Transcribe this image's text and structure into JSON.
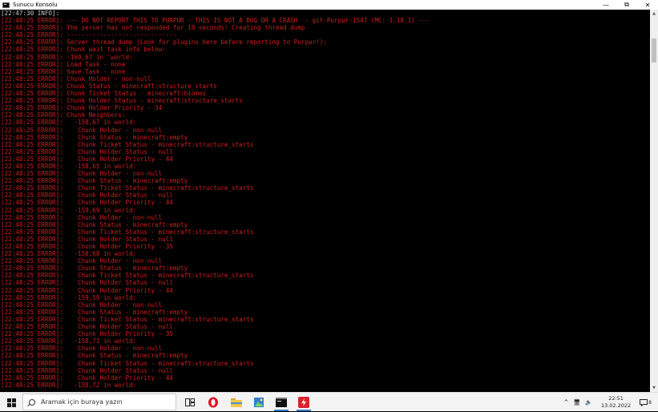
{
  "window": {
    "title": "Sunucu Konsolu",
    "minimize": "—",
    "maximize": "⧉",
    "close": "✕"
  },
  "console_lines": [
    {
      "t": "[22:47:30 INFO]:",
      "k": "info"
    },
    {
      "t": "[22:48:25 ERROR]: --- DO NOT REPORT THIS TO PURPUR - THIS IS NOT A BUG OR A CRASH  - git-Purpur-1547 (MC: 1.18.1) ---",
      "k": "err"
    },
    {
      "t": "[22:48:25 ERROR]: The server has not responded for 10 seconds! Creating thread dump",
      "k": "err"
    },
    {
      "t": "[22:48:25 ERROR]: ------------------------------",
      "k": "err"
    },
    {
      "t": "[22:48:25 ERROR]: Server thread dump (Look for plugins here before reporting to Purpur!):",
      "k": "err"
    },
    {
      "t": "[22:48:25 ERROR]: Chunk wait task info below:",
      "k": "err"
    },
    {
      "t": "[22:48:25 ERROR]: -160,67 in 'world:",
      "k": "err"
    },
    {
      "t": "[22:48:25 ERROR]: Load Task - none",
      "k": "err"
    },
    {
      "t": "[22:48:25 ERROR]: Save Task - none",
      "k": "err"
    },
    {
      "t": "[22:48:25 ERROR]: Chunk Holder - non-null",
      "k": "err"
    },
    {
      "t": "[22:48:25 ERROR]: Chunk Status - minecraft:structure_starts",
      "k": "err"
    },
    {
      "t": "[22:48:25 ERROR]: Chunk Ticket Status - minecraft:biomes",
      "k": "err"
    },
    {
      "t": "[22:48:25 ERROR]: Chunk Holder Status - minecraft:structure_starts",
      "k": "err"
    },
    {
      "t": "[22:48:25 ERROR]: Chunk Holder Priority - 34",
      "k": "err"
    },
    {
      "t": "[22:48:25 ERROR]: Chunk Neighbors:",
      "k": "err"
    },
    {
      "t": "[22:48:25 ERROR]:   -158,67 in world:",
      "k": "err"
    },
    {
      "t": "[22:48:25 ERROR]:    Chunk Holder - non-null",
      "k": "err"
    },
    {
      "t": "[22:48:25 ERROR]:    Chunk Status - minecraft:empty",
      "k": "err"
    },
    {
      "t": "[22:48:25 ERROR]:    Chunk Ticket Status - minecraft:structure_starts",
      "k": "err"
    },
    {
      "t": "[22:48:25 ERROR]:    Chunk Holder Status - null",
      "k": "err"
    },
    {
      "t": "[22:48:25 ERROR]:    Chunk Holder Priority - 44",
      "k": "err"
    },
    {
      "t": "[22:48:25 ERROR]:   -158,65 in world:",
      "k": "err"
    },
    {
      "t": "[22:48:25 ERROR]:    Chunk Holder - non-null",
      "k": "err"
    },
    {
      "t": "[22:48:25 ERROR]:    Chunk Status - minecraft:empty",
      "k": "err"
    },
    {
      "t": "[22:48:25 ERROR]:    Chunk Ticket Status - minecraft:structure_starts",
      "k": "err"
    },
    {
      "t": "[22:48:25 ERROR]:    Chunk Holder Status - null",
      "k": "err"
    },
    {
      "t": "[22:48:25 ERROR]:    Chunk Holder Priority - 44",
      "k": "err"
    },
    {
      "t": "[22:48:25 ERROR]:   -159,69 in world:",
      "k": "err"
    },
    {
      "t": "[22:48:25 ERROR]:    Chunk Holder - non-null",
      "k": "err"
    },
    {
      "t": "[22:48:25 ERROR]:    Chunk Status - minecraft:empty",
      "k": "err"
    },
    {
      "t": "[22:48:25 ERROR]:    Chunk Ticket Status - minecraft:structure_starts",
      "k": "err"
    },
    {
      "t": "[22:48:25 ERROR]:    Chunk Holder Status - null",
      "k": "err"
    },
    {
      "t": "[22:48:25 ERROR]:    Chunk Holder Priority - 35",
      "k": "err"
    },
    {
      "t": "[22:48:25 ERROR]:   -158,68 in world:",
      "k": "err"
    },
    {
      "t": "[22:48:25 ERROR]:    Chunk Holder - non-null",
      "k": "err"
    },
    {
      "t": "[22:48:25 ERROR]:    Chunk Status - minecraft:empty",
      "k": "err"
    },
    {
      "t": "[22:48:25 ERROR]:    Chunk Ticket Status - minecraft:structure_starts",
      "k": "err"
    },
    {
      "t": "[22:48:25 ERROR]:    Chunk Holder Status - null",
      "k": "err"
    },
    {
      "t": "[22:48:25 ERROR]:    Chunk Holder Priority - 44",
      "k": "err"
    },
    {
      "t": "[22:48:25 ERROR]:   -159,59 in world:",
      "k": "err"
    },
    {
      "t": "[22:48:25 ERROR]:    Chunk Holder - non-null",
      "k": "err"
    },
    {
      "t": "[22:48:25 ERROR]:    Chunk Status - minecraft:empty",
      "k": "err"
    },
    {
      "t": "[22:48:25 ERROR]:    Chunk Ticket Status - minecraft:structure_starts",
      "k": "err"
    },
    {
      "t": "[22:48:25 ERROR]:    Chunk Holder Status - null",
      "k": "err"
    },
    {
      "t": "[22:48:25 ERROR]:    Chunk Holder Priority - 35",
      "k": "err"
    },
    {
      "t": "[22:48:25 ERROR]:   -158,71 in world:",
      "k": "err"
    },
    {
      "t": "[22:48:25 ERROR]:    Chunk Holder - non-null",
      "k": "err"
    },
    {
      "t": "[22:48:25 ERROR]:    Chunk Status - minecraft:empty",
      "k": "err"
    },
    {
      "t": "[22:48:25 ERROR]:    Chunk Ticket Status - minecraft:structure_starts",
      "k": "err"
    },
    {
      "t": "[22:48:25 ERROR]:    Chunk Holder Status - null",
      "k": "err"
    },
    {
      "t": "[22:48:25 ERROR]:    Chunk Holder Priority - 44",
      "k": "err"
    },
    {
      "t": "[22:48:25 ERROR]:   -158,72 in world:",
      "k": "err"
    }
  ],
  "taskbar": {
    "search_placeholder": "Aramak için buraya yazın",
    "icons": [
      "task-view-icon",
      "opera-icon",
      "file-explorer-icon",
      "photos-icon",
      "console-icon",
      "app-flash-icon"
    ],
    "tray_chevron": "^",
    "tray_network": "🖥",
    "tray_volume": "🔉",
    "time": "22:51",
    "date": "13.02.2022",
    "notifications": "8",
    "colors": {
      "accent": "#3a78c4",
      "error_text": "#d41e1e",
      "info_text": "#c8c8c8"
    }
  }
}
